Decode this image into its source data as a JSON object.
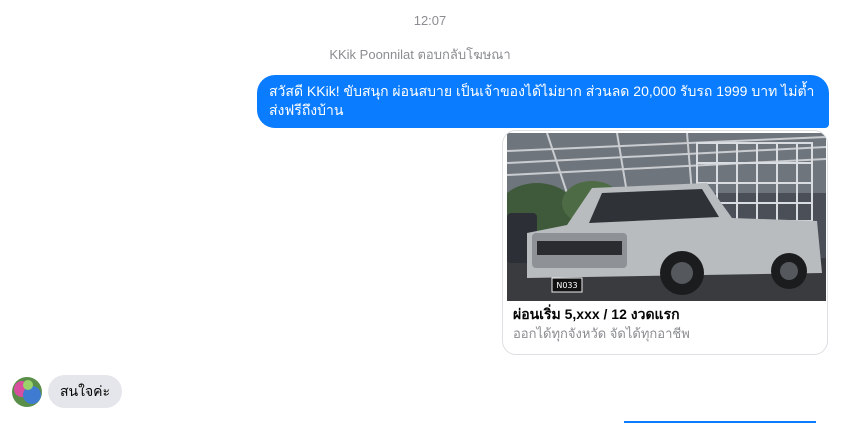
{
  "conversation": {
    "timestamp": "12:07",
    "reply_note": "KKik Poonnilat ตอบกลับโฆษณา"
  },
  "sent_message": {
    "text": "สวัสดี KKik! ขับสนุก ผ่อนสบาย เป็นเจ้าของได้ไม่ยาก ส่วนลด 20,000  รับรถ 1999 บาท ไม่ต้ำส่งฟรีถึงบ้าน"
  },
  "ad_card": {
    "image": "silver-pickup-truck-with-cargo-rack",
    "plate_text": "N033",
    "title": "ผ่อนเริ่ม 5,xxx / 12 งวดแรก",
    "subtitle": "ออกได้ทุกจังหวัด จัดได้ทุกอาชีพ"
  },
  "received_message": {
    "avatar": "user-avatar",
    "text": "สนใจค่ะ"
  },
  "colors": {
    "sent_bubble": "#0a7cff",
    "received_bubble": "#e4e6eb",
    "meta_text": "#8a8d91"
  }
}
